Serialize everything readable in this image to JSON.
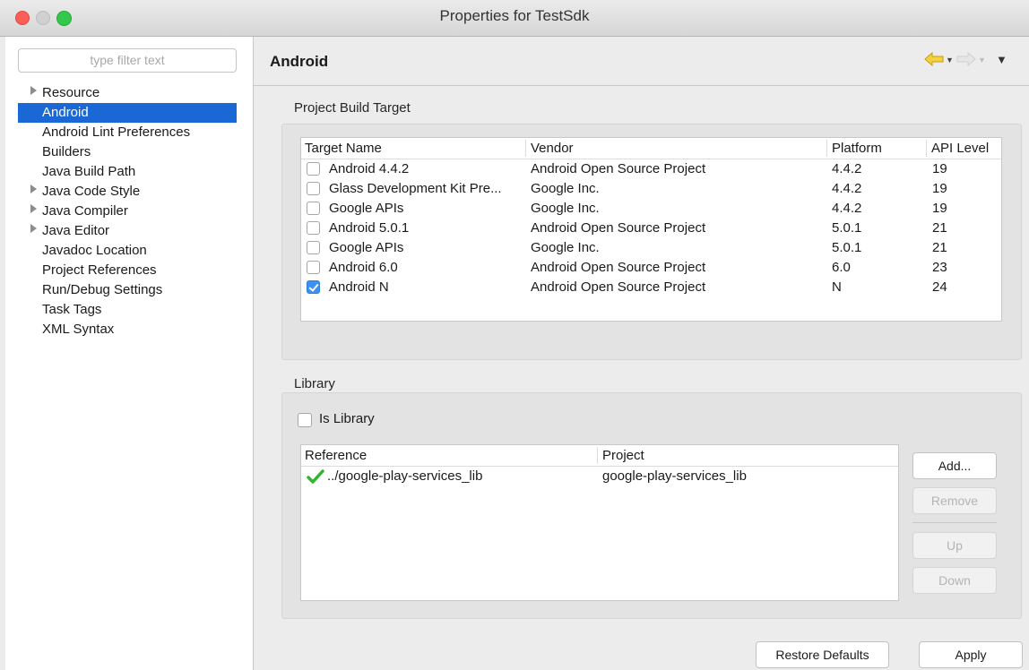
{
  "window": {
    "title": "Properties for TestSdk"
  },
  "sidebar": {
    "filter_placeholder": "type filter text",
    "items": [
      {
        "label": "Resource",
        "expandable": true
      },
      {
        "label": "Android",
        "selected": true
      },
      {
        "label": "Android Lint Preferences"
      },
      {
        "label": "Builders"
      },
      {
        "label": "Java Build Path"
      },
      {
        "label": "Java Code Style",
        "expandable": true
      },
      {
        "label": "Java Compiler",
        "expandable": true
      },
      {
        "label": "Java Editor",
        "expandable": true
      },
      {
        "label": "Javadoc Location"
      },
      {
        "label": "Project References"
      },
      {
        "label": "Run/Debug Settings"
      },
      {
        "label": "Task Tags"
      },
      {
        "label": "XML Syntax"
      }
    ]
  },
  "page": {
    "title": "Android",
    "nav_icons": [
      "back-arrow-icon",
      "forward-arrow-icon",
      "view-menu-icon"
    ]
  },
  "build_target": {
    "section_label": "Project Build Target",
    "columns": [
      "Target Name",
      "Vendor",
      "Platform",
      "API Level"
    ],
    "rows": [
      {
        "checked": false,
        "name": "Android 4.4.2",
        "vendor": "Android Open Source Project",
        "platform": "4.4.2",
        "api": "19"
      },
      {
        "checked": false,
        "name": "Glass Development Kit Pre...",
        "vendor": "Google Inc.",
        "platform": "4.4.2",
        "api": "19"
      },
      {
        "checked": false,
        "name": "Google APIs",
        "vendor": "Google Inc.",
        "platform": "4.4.2",
        "api": "19"
      },
      {
        "checked": false,
        "name": "Android 5.0.1",
        "vendor": "Android Open Source Project",
        "platform": "5.0.1",
        "api": "21"
      },
      {
        "checked": false,
        "name": "Google APIs",
        "vendor": "Google Inc.",
        "platform": "5.0.1",
        "api": "21"
      },
      {
        "checked": false,
        "name": "Android 6.0",
        "vendor": "Android Open Source Project",
        "platform": "6.0",
        "api": "23"
      },
      {
        "checked": true,
        "name": "Android N",
        "vendor": "Android Open Source Project",
        "platform": "N",
        "api": "24"
      }
    ]
  },
  "library": {
    "section_label": "Library",
    "is_library_label": "Is Library",
    "is_library_checked": false,
    "columns": [
      "Reference",
      "Project"
    ],
    "rows": [
      {
        "reference": "../google-play-services_lib",
        "project": "google-play-services_lib",
        "status_icon": "green-check-icon"
      }
    ],
    "buttons": {
      "add": "Add...",
      "remove": "Remove",
      "up": "Up",
      "down": "Down"
    }
  },
  "footer": {
    "restore_defaults": "Restore Defaults",
    "apply": "Apply"
  },
  "colors": {
    "selection": "#1a68d6",
    "checkbox_checked": "#3d8ff0",
    "valid_check": "#2fb52f",
    "nav_arrow": "#f0c419"
  }
}
